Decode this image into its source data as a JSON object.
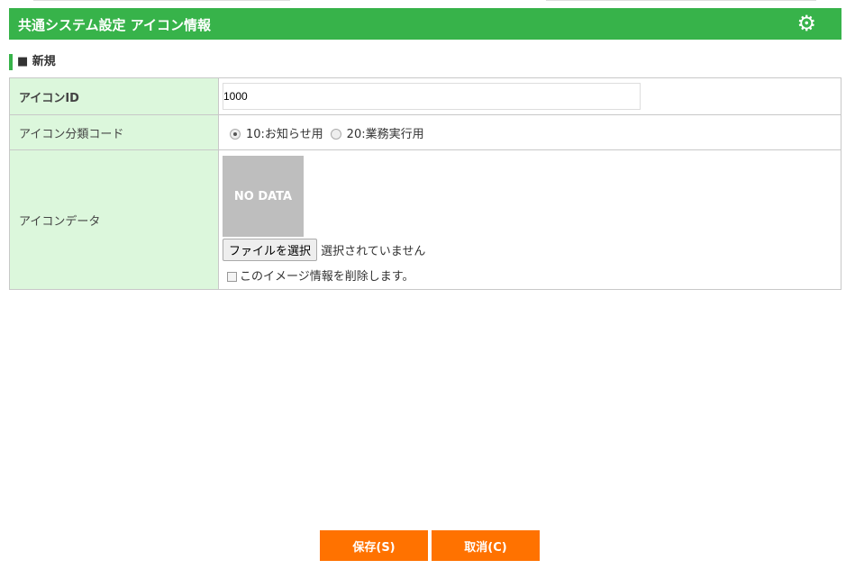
{
  "header": {
    "title": "共通システム設定 アイコン情報",
    "icon": "gear-icon"
  },
  "section": {
    "title": "■ 新規"
  },
  "form": {
    "icon_id_label": "アイコンID",
    "icon_id_value": "1000",
    "category_label": "アイコン分類コード",
    "category_options": [
      "10:お知らせ用",
      "20:業務実行用"
    ],
    "category_selected": "10:お知らせ用",
    "data_label": "アイコンデータ",
    "no_data": "NO DATA",
    "file_button": "ファイルを選択",
    "file_status": "選択されていません",
    "delete_label": "このイメージ情報を削除します。"
  },
  "buttons": {
    "save": "保存(S)",
    "cancel": "取消(C)"
  }
}
